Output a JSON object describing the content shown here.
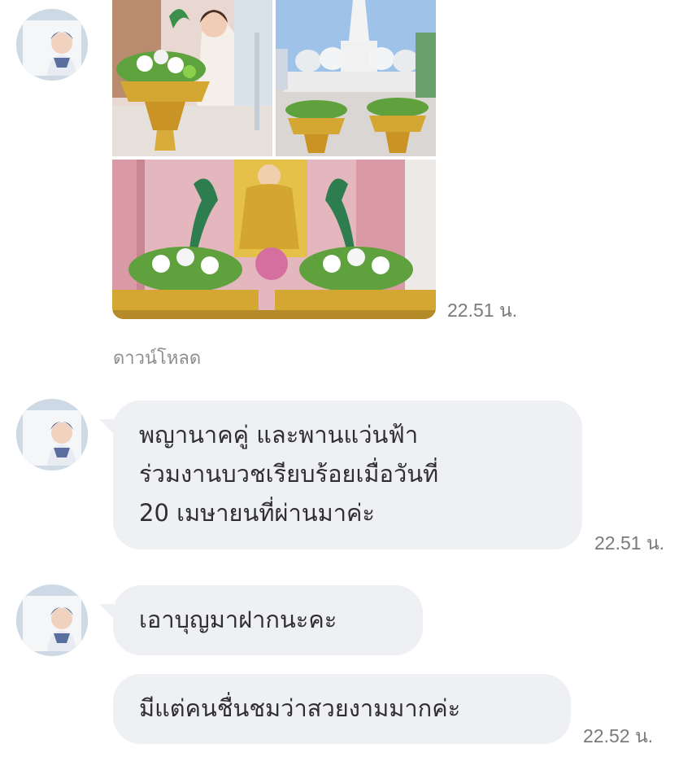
{
  "chat": {
    "photo_message": {
      "time": "22.51 น.",
      "download_label": "ดาวน์โหลด"
    },
    "messages": [
      {
        "text": "พญานาคคู่ และพานแว่นฟ้า\nร่วมงานบวชเรียบร้อยเมื่อวันที่\n20 เมษายนที่ผ่านมาค่ะ",
        "time": "22.51 น."
      },
      {
        "text": "เอาบุญมาฝากนะคะ",
        "time": ""
      },
      {
        "text": "มีแต่คนชื่นชมว่าสวยงามมากค่ะ",
        "time": "22.52 น."
      }
    ]
  },
  "icons": {
    "avatar": "user-avatar-icon"
  }
}
